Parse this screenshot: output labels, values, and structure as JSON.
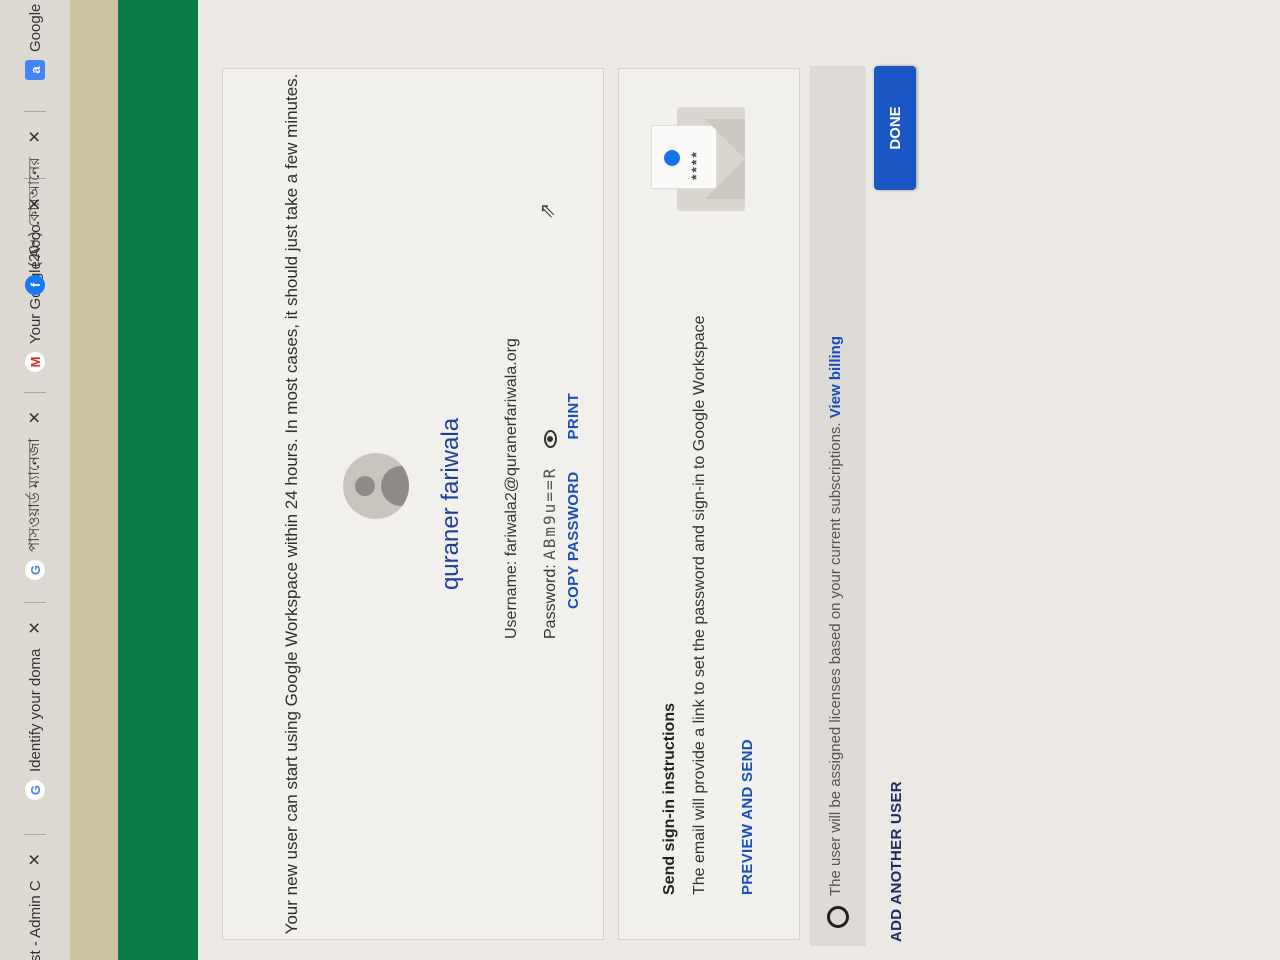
{
  "tabs": [
    {
      "label": "st - Admin C",
      "favicon": "google-g-icon",
      "favicon_color": "#4285f4"
    },
    {
      "label": "Identify your doma",
      "favicon": "google-g-icon",
      "favicon_color": "#4285f4"
    },
    {
      "label": "পাসওয়ার্ড ম্যানেজা",
      "favicon": "google-g-icon",
      "favicon_color": "#4285f4"
    },
    {
      "label": "Your Google Acco",
      "favicon": "gmail-icon",
      "favicon_color": "#d93025"
    },
    {
      "label": "(20+) কোরআনের",
      "favicon": "facebook-icon",
      "favicon_color": "#1877f2"
    },
    {
      "label": "Google",
      "favicon": "google-docs-icon",
      "favicon_color": "#4285f4"
    }
  ],
  "confirmation": {
    "intro": "Your new user can start using Google Workspace within 24 hours. In most cases, it should just take a few minutes.",
    "full_name": "quraner fariwala",
    "username_label": "Username:",
    "username": "fariwala2@quranerfariwala.org",
    "password_label": "Password:",
    "password": "ABm9u==R",
    "copy_password": "COPY PASSWORD",
    "print": "PRINT"
  },
  "send_instructions": {
    "title": "Send sign-in instructions",
    "text": "The email will provide a link to set the password and sign-in to Google Workspace",
    "preview_send": "PREVIEW AND SEND",
    "envelope_stars": "****"
  },
  "license_notice": {
    "text": "The user will be assigned licenses based on your current subscriptions.",
    "link": "View billing"
  },
  "footer": {
    "add_another": "ADD ANOTHER USER",
    "done": "DONE"
  },
  "colors": {
    "accent": "#1a56c4",
    "link": "#1a4fb8",
    "header_green": "#0c7a48"
  }
}
